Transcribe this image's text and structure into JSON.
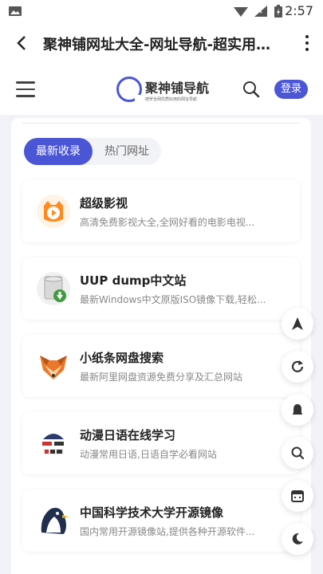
{
  "status_bar": {
    "time": "2:57"
  },
  "app_bar": {
    "title": "聚神铺网址大全-网址导航-超实用的..."
  },
  "site_header": {
    "logo_name": "聚神铺导航",
    "logo_tagline": "搜罗全网优质好用的网址导航",
    "login_label": "登录"
  },
  "tabs": [
    {
      "label": "最新收录",
      "active": true
    },
    {
      "label": "热门网址",
      "active": false
    }
  ],
  "sites": [
    {
      "name": "超级影视",
      "desc": "高清免费影视大全,全网好看的电影电视...",
      "icon": "orange-play-icon"
    },
    {
      "name": "UUP dump中文站",
      "desc": "最新Windows中文原版ISO镜像下载,轻松...",
      "icon": "disk-download-icon"
    },
    {
      "name": "小纸条网盘搜索",
      "desc": "最新阿里网盘资源免费分享及汇总网站",
      "icon": "fox-icon"
    },
    {
      "name": "动漫日语在线学习",
      "desc": "动漫常用日语,日语自学必看网站",
      "icon": "anime-japanese-icon"
    },
    {
      "name": "中国科学技术大学开源镜像",
      "desc": "国内常用开源镜像站,提供各种开源软件...",
      "icon": "penguin-icon"
    }
  ],
  "floating_actions": [
    "navigate-icon",
    "refresh-icon",
    "notification-icon",
    "search-icon",
    "calendar-icon",
    "dark-mode-icon"
  ],
  "colors": {
    "accent": "#4a56d6"
  }
}
